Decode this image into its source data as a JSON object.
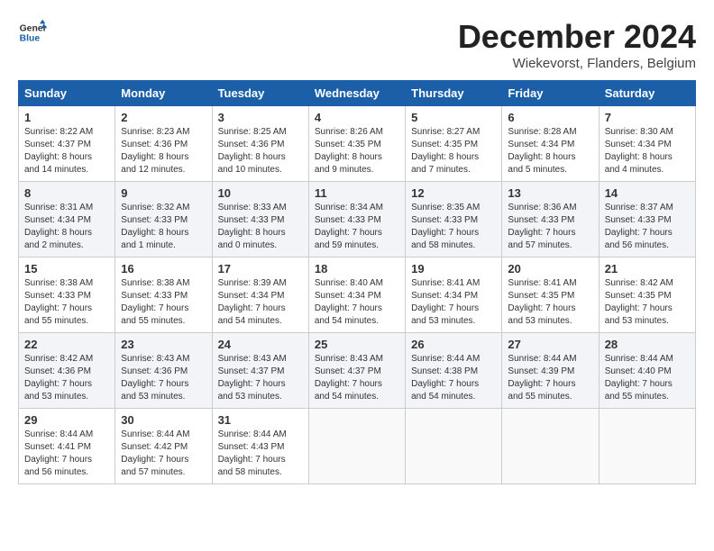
{
  "header": {
    "logo_line1": "General",
    "logo_line2": "Blue",
    "month": "December 2024",
    "location": "Wiekevorst, Flanders, Belgium"
  },
  "days_of_week": [
    "Sunday",
    "Monday",
    "Tuesday",
    "Wednesday",
    "Thursday",
    "Friday",
    "Saturday"
  ],
  "weeks": [
    [
      {
        "day": "1",
        "sunrise": "8:22 AM",
        "sunset": "4:37 PM",
        "daylight": "8 hours and 14 minutes."
      },
      {
        "day": "2",
        "sunrise": "8:23 AM",
        "sunset": "4:36 PM",
        "daylight": "8 hours and 12 minutes."
      },
      {
        "day": "3",
        "sunrise": "8:25 AM",
        "sunset": "4:36 PM",
        "daylight": "8 hours and 10 minutes."
      },
      {
        "day": "4",
        "sunrise": "8:26 AM",
        "sunset": "4:35 PM",
        "daylight": "8 hours and 9 minutes."
      },
      {
        "day": "5",
        "sunrise": "8:27 AM",
        "sunset": "4:35 PM",
        "daylight": "8 hours and 7 minutes."
      },
      {
        "day": "6",
        "sunrise": "8:28 AM",
        "sunset": "4:34 PM",
        "daylight": "8 hours and 5 minutes."
      },
      {
        "day": "7",
        "sunrise": "8:30 AM",
        "sunset": "4:34 PM",
        "daylight": "8 hours and 4 minutes."
      }
    ],
    [
      {
        "day": "8",
        "sunrise": "8:31 AM",
        "sunset": "4:34 PM",
        "daylight": "8 hours and 2 minutes."
      },
      {
        "day": "9",
        "sunrise": "8:32 AM",
        "sunset": "4:33 PM",
        "daylight": "8 hours and 1 minute."
      },
      {
        "day": "10",
        "sunrise": "8:33 AM",
        "sunset": "4:33 PM",
        "daylight": "8 hours and 0 minutes."
      },
      {
        "day": "11",
        "sunrise": "8:34 AM",
        "sunset": "4:33 PM",
        "daylight": "7 hours and 59 minutes."
      },
      {
        "day": "12",
        "sunrise": "8:35 AM",
        "sunset": "4:33 PM",
        "daylight": "7 hours and 58 minutes."
      },
      {
        "day": "13",
        "sunrise": "8:36 AM",
        "sunset": "4:33 PM",
        "daylight": "7 hours and 57 minutes."
      },
      {
        "day": "14",
        "sunrise": "8:37 AM",
        "sunset": "4:33 PM",
        "daylight": "7 hours and 56 minutes."
      }
    ],
    [
      {
        "day": "15",
        "sunrise": "8:38 AM",
        "sunset": "4:33 PM",
        "daylight": "7 hours and 55 minutes."
      },
      {
        "day": "16",
        "sunrise": "8:38 AM",
        "sunset": "4:33 PM",
        "daylight": "7 hours and 55 minutes."
      },
      {
        "day": "17",
        "sunrise": "8:39 AM",
        "sunset": "4:34 PM",
        "daylight": "7 hours and 54 minutes."
      },
      {
        "day": "18",
        "sunrise": "8:40 AM",
        "sunset": "4:34 PM",
        "daylight": "7 hours and 54 minutes."
      },
      {
        "day": "19",
        "sunrise": "8:41 AM",
        "sunset": "4:34 PM",
        "daylight": "7 hours and 53 minutes."
      },
      {
        "day": "20",
        "sunrise": "8:41 AM",
        "sunset": "4:35 PM",
        "daylight": "7 hours and 53 minutes."
      },
      {
        "day": "21",
        "sunrise": "8:42 AM",
        "sunset": "4:35 PM",
        "daylight": "7 hours and 53 minutes."
      }
    ],
    [
      {
        "day": "22",
        "sunrise": "8:42 AM",
        "sunset": "4:36 PM",
        "daylight": "7 hours and 53 minutes."
      },
      {
        "day": "23",
        "sunrise": "8:43 AM",
        "sunset": "4:36 PM",
        "daylight": "7 hours and 53 minutes."
      },
      {
        "day": "24",
        "sunrise": "8:43 AM",
        "sunset": "4:37 PM",
        "daylight": "7 hours and 53 minutes."
      },
      {
        "day": "25",
        "sunrise": "8:43 AM",
        "sunset": "4:37 PM",
        "daylight": "7 hours and 54 minutes."
      },
      {
        "day": "26",
        "sunrise": "8:44 AM",
        "sunset": "4:38 PM",
        "daylight": "7 hours and 54 minutes."
      },
      {
        "day": "27",
        "sunrise": "8:44 AM",
        "sunset": "4:39 PM",
        "daylight": "7 hours and 55 minutes."
      },
      {
        "day": "28",
        "sunrise": "8:44 AM",
        "sunset": "4:40 PM",
        "daylight": "7 hours and 55 minutes."
      }
    ],
    [
      {
        "day": "29",
        "sunrise": "8:44 AM",
        "sunset": "4:41 PM",
        "daylight": "7 hours and 56 minutes."
      },
      {
        "day": "30",
        "sunrise": "8:44 AM",
        "sunset": "4:42 PM",
        "daylight": "7 hours and 57 minutes."
      },
      {
        "day": "31",
        "sunrise": "8:44 AM",
        "sunset": "4:43 PM",
        "daylight": "7 hours and 58 minutes."
      },
      null,
      null,
      null,
      null
    ]
  ]
}
